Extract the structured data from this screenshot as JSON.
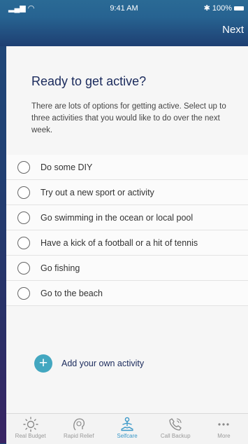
{
  "status_bar": {
    "signal": "▂▄▆",
    "wifi": "◠",
    "time": "9:41 AM",
    "bluetooth": "✱",
    "battery": "100%"
  },
  "nav": {
    "next_label": "Next"
  },
  "intro": {
    "title": "Ready to get active?",
    "body": "There are lots of options for getting active. Select up to three activities that you would like to do over the next week."
  },
  "options": [
    {
      "label": "Do some DIY"
    },
    {
      "label": "Try out a new sport or activity"
    },
    {
      "label": "Go swimming in the ocean or local pool"
    },
    {
      "label": "Have a kick of a football or a hit of tennis"
    },
    {
      "label": "Go fishing"
    },
    {
      "label": "Go to the beach"
    }
  ],
  "add": {
    "icon": "+",
    "label": "Add your own activity"
  },
  "tabs": [
    {
      "label": "Real Budget",
      "icon": "sun-icon"
    },
    {
      "label": "Rapid Relief",
      "icon": "head-icon"
    },
    {
      "label": "Selfcare",
      "icon": "meditation-icon",
      "active": true
    },
    {
      "label": "Call Backup",
      "icon": "phone-icon"
    },
    {
      "label": "More",
      "icon": "more-icon"
    }
  ],
  "colors": {
    "accent": "#3a98c8",
    "add_button": "#43a7c0",
    "title": "#1a2a5c"
  }
}
